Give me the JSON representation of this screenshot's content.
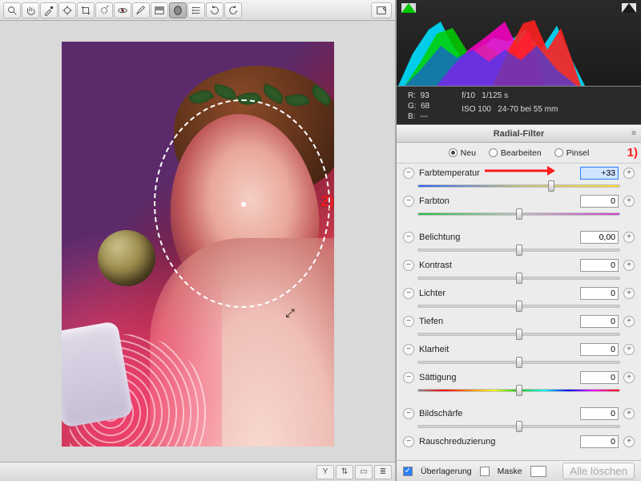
{
  "toolbar": {
    "tools": [
      "zoom",
      "hand",
      "eyedropper",
      "sampler",
      "crop",
      "spot",
      "eye",
      "brush",
      "gradient",
      "radial",
      "list",
      "rotate-ccw",
      "rotate-cw"
    ],
    "active_tool": "radial"
  },
  "exif": {
    "r_label": "R:",
    "r": "93",
    "g_label": "G:",
    "g": "68",
    "b_label": "B:",
    "b": "---",
    "aperture": "f/10",
    "shutter": "1/125 s",
    "iso": "ISO 100",
    "lens": "24-70 bei 55 mm"
  },
  "panel": {
    "title": "Radial-Filter",
    "modes": {
      "new": "Neu",
      "edit": "Bearbeiten",
      "brush": "Pinsel"
    },
    "selected_mode": "new"
  },
  "sliders": {
    "temperature": {
      "label": "Farbtemperatur",
      "value": "+33",
      "pos": 66,
      "track": "temp",
      "highlight": true
    },
    "tint": {
      "label": "Farbton",
      "value": "0",
      "pos": 50,
      "track": "tint"
    },
    "exposure": {
      "label": "Belichtung",
      "value": "0,00",
      "pos": 50
    },
    "contrast": {
      "label": "Kontrast",
      "value": "0",
      "pos": 50
    },
    "highlights": {
      "label": "Lichter",
      "value": "0",
      "pos": 50
    },
    "shadows": {
      "label": "Tiefen",
      "value": "0",
      "pos": 50
    },
    "clarity": {
      "label": "Klarheit",
      "value": "0",
      "pos": 50
    },
    "saturation": {
      "label": "Sättigung",
      "value": "0",
      "pos": 50,
      "track": "sat"
    },
    "sharpness": {
      "label": "Bildschärfe",
      "value": "0",
      "pos": 50
    },
    "noise": {
      "label": "Rauschreduzierung",
      "value": "0",
      "pos": 50
    }
  },
  "footer": {
    "overlay_label": "Überlagerung",
    "overlay_checked": true,
    "mask_label": "Maske",
    "mask_checked": false,
    "clear_all": "Alle löschen"
  },
  "annotations": {
    "one": "1)",
    "two": "2)"
  }
}
